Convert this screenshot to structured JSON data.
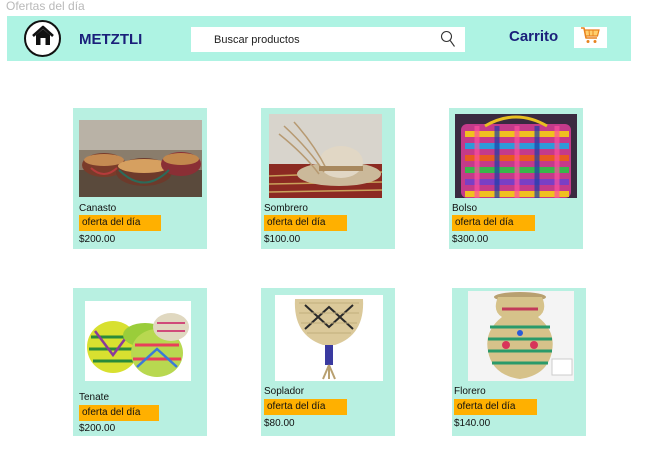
{
  "page": {
    "title": "Ofertas del día"
  },
  "navbar": {
    "brand": "METZTLI",
    "search_placeholder": "Buscar productos",
    "cart_label": "Carrito",
    "icons": {
      "home": "home-icon",
      "search": "search-icon",
      "cart": "cart-icon"
    }
  },
  "products": [
    {
      "name": "Canasto",
      "badge": "oferta del día",
      "price": "$200.00"
    },
    {
      "name": "Sombrero",
      "badge": "oferta del día",
      "price": "$100.00"
    },
    {
      "name": "Bolso",
      "badge": "oferta del día",
      "price": "$300.00"
    },
    {
      "name": "Tenate",
      "badge": "oferta del día",
      "price": "$200.00"
    },
    {
      "name": "Soplador",
      "badge": "oferta del día",
      "price": "$80.00"
    },
    {
      "name": "Florero",
      "badge": "oferta del día",
      "price": "$140.00"
    }
  ],
  "colors": {
    "navbar": "#aef3e3",
    "card": "#b8f0e1",
    "badge": "#ffb000",
    "brand_text": "#1a1f7a"
  }
}
